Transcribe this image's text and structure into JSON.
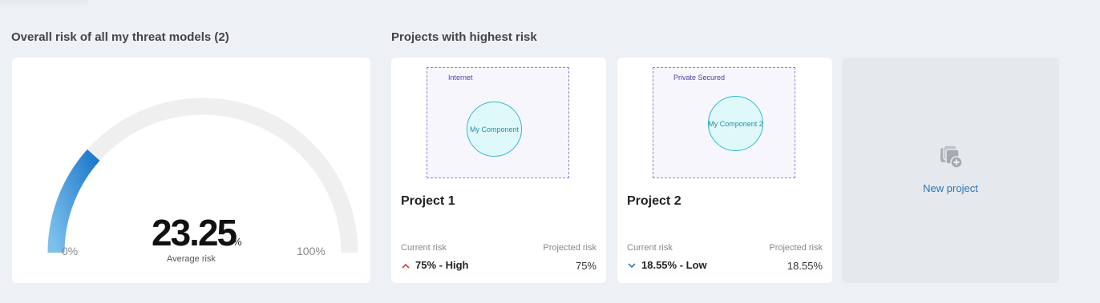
{
  "sections": {
    "overall_title": "Overall risk of all my threat models (2)",
    "projects_title": "Projects with highest risk"
  },
  "gauge": {
    "value": "23.25",
    "unit": "%",
    "caption": "Average risk",
    "min_label": "0%",
    "max_label": "100%",
    "fraction": 0.2325,
    "track_color": "#efefef",
    "fill_color": "#2f86d6"
  },
  "projects": [
    {
      "name": "Project 1",
      "zone_label": "Internet",
      "component_label": "My Component",
      "current_risk_label": "Current risk",
      "projected_risk_label": "Projected risk",
      "current_risk": "75% - High",
      "projected_risk": "75%",
      "trend_icon": "chevron-up-icon"
    },
    {
      "name": "Project 2",
      "zone_label": "Private Secured",
      "component_label": "My Component 2",
      "current_risk_label": "Current risk",
      "projected_risk_label": "Projected risk",
      "current_risk": "18.55% - Low",
      "projected_risk": "18.55%",
      "trend_icon": "chevron-down-icon"
    }
  ],
  "new_project": {
    "label": "New project",
    "icon": "new-project-icon"
  }
}
